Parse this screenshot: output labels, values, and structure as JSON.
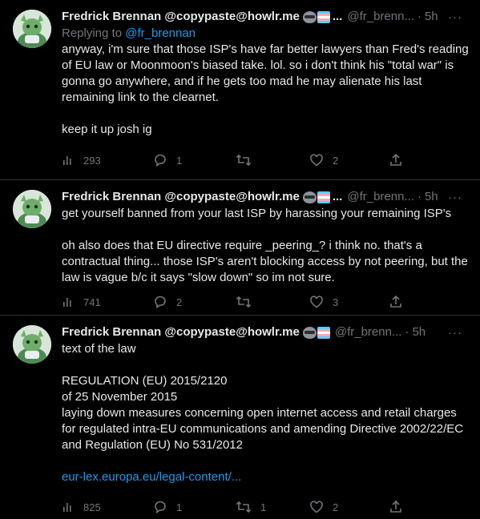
{
  "colors": {
    "background": "#000000",
    "text_primary": "#e7e9ea",
    "text_secondary": "#71767b",
    "accent": "#1d9bf0",
    "divider": "#2f3336"
  },
  "tweets": [
    {
      "author_name": "Fredrick Brennan @copypaste@howlr.me",
      "name_emojis": [
        "raccoon-emoji",
        "trans-flag-emoji"
      ],
      "name_overflow": "...",
      "handle": "@fr_brenn...",
      "separator": "·",
      "time": "5h",
      "more_label": "···",
      "replying_prefix": "Replying to",
      "replying_to": "@fr_brennan",
      "paragraphs": [
        "anyway, i'm sure that those ISP's have far better lawyers than Fred's reading of EU law or Moonmoon's biased take. lol. so i don't think his \"total war\" is gonna go anywhere, and if he gets too mad he may alienate his last remaining link to the clearnet.",
        "keep it up josh ig"
      ],
      "stats": {
        "views": "293",
        "replies": "1",
        "retweets": "",
        "likes": "2"
      }
    },
    {
      "author_name": "Fredrick Brennan @copypaste@howlr.me",
      "name_emojis": [
        "raccoon-emoji",
        "trans-flag-emoji"
      ],
      "name_overflow": "...",
      "handle": "@fr_brenn...",
      "separator": "·",
      "time": "5h",
      "more_label": "···",
      "paragraphs": [
        "get yourself banned from your last ISP by harassing your remaining ISP's",
        "oh also does that EU directive require _peering_? i think no. that's a contractual thing... those ISP's aren't blocking access by not peering, but the law is vague b/c it says \"slow down\" so im not sure."
      ],
      "stats": {
        "views": "741",
        "replies": "2",
        "retweets": "",
        "likes": "3"
      }
    },
    {
      "author_name": "Fredrick Brennan @copypaste@howlr.me",
      "name_emojis": [
        "raccoon-emoji",
        "trans-flag-emoji"
      ],
      "name_overflow": "",
      "handle": "@fr_brenn...",
      "separator": "·",
      "time": "5h",
      "more_label": "···",
      "paragraphs": [
        "text of the law",
        "REGULATION (EU) 2015/2120\nof 25 November 2015\nlaying down measures concerning open internet access and retail charges for regulated intra-EU communications and amending Directive 2002/22/EC and Regulation (EU) No 531/2012"
      ],
      "link": "eur-lex.europa.eu/legal-content/...",
      "stats": {
        "views": "825",
        "replies": "1",
        "retweets": "1",
        "likes": "2"
      }
    }
  ]
}
